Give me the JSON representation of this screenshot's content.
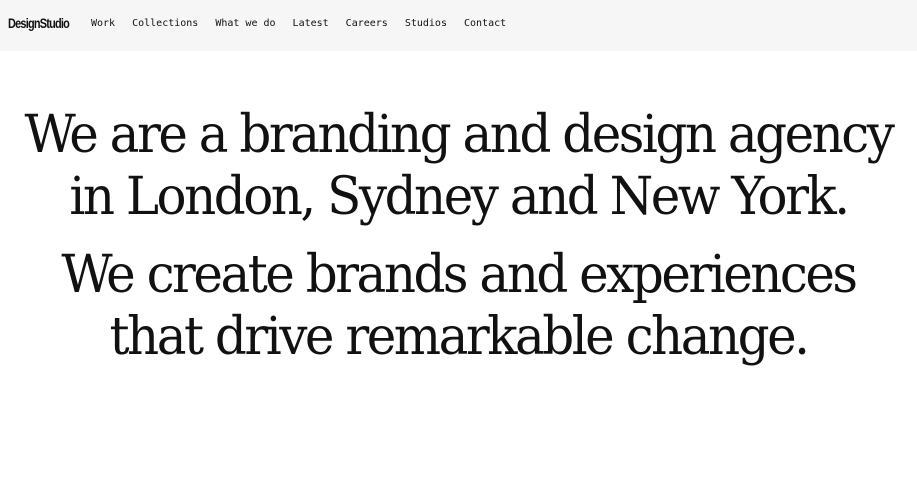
{
  "header": {
    "logo": "DesignStudio",
    "nav": [
      "Work",
      "Collections",
      "What we do",
      "Latest",
      "Careers",
      "Studios",
      "Contact"
    ]
  },
  "hero": {
    "line_one": "We are a branding and design agency in London, Sydney and New York.",
    "line_two": "We create brands and experiences that drive remarkable change."
  },
  "colors": {
    "header_background": "#f6f6f6",
    "text": "#111111",
    "page_background": "#ffffff"
  }
}
